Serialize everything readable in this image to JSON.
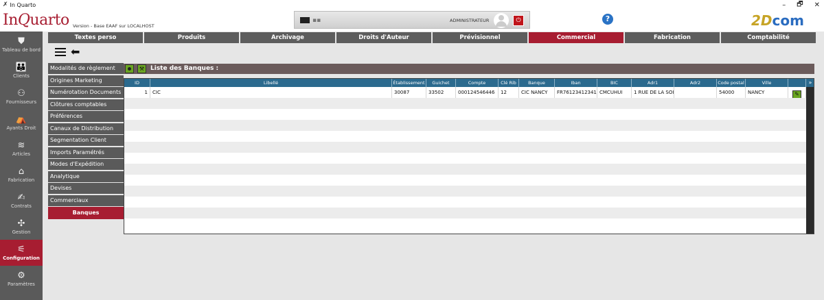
{
  "window": {
    "title": "In Quarto",
    "minimize": "–",
    "maximize": "🗗",
    "close": "✕"
  },
  "header": {
    "logo_prefix": "In",
    "logo_q": "Q",
    "logo_suffix": "uarto",
    "version": "Version - Base EAAF sur LOCALHOST",
    "user_name": "ADMINISTRATEUR",
    "help": "?",
    "brand_two": "2D",
    "brand_com": "com"
  },
  "leftnav": [
    {
      "label": "Tableau de bord",
      "icon": "⛊"
    },
    {
      "label": "Clients",
      "icon": "👪"
    },
    {
      "label": "Fournisseurs",
      "icon": "⚇"
    },
    {
      "label": "Ayants Droit",
      "icon": "⛺"
    },
    {
      "label": "Articles",
      "icon": "≋"
    },
    {
      "label": "Fabrication",
      "icon": "⌂"
    },
    {
      "label": "Contrats",
      "icon": "✍"
    },
    {
      "label": "Gestion",
      "icon": "✣"
    },
    {
      "label": "Configuration",
      "icon": "⚟"
    },
    {
      "label": "Paramètres",
      "icon": "⚙"
    }
  ],
  "tabs": [
    "Textes perso",
    "Produits",
    "Archivage",
    "Droits d'Auteur",
    "Prévisionnel",
    "Commercial",
    "Fabrication",
    "Comptabilité"
  ],
  "submenu": [
    "Modalités de règlement",
    "Origines Marketing",
    "Numérotation Documents",
    "Clôtures comptables",
    "Préférences",
    "Canaux de Distribution",
    "Segmentation Client",
    "Imports Paramétrés",
    "Modes d'Expédition",
    "Analytique",
    "Devises",
    "Commerciaux",
    "Banques"
  ],
  "list": {
    "title": "Liste des Banques :",
    "columns": [
      "ID",
      "Libellé",
      "Établissement",
      "Guichet",
      "Compte",
      "Clé Rib",
      "Banque",
      "Iban",
      "BIC",
      "Adr1",
      "Adr2",
      "Code postal",
      "Ville",
      ""
    ],
    "rows": [
      [
        "1",
        "CIC",
        "30087",
        "33502",
        "000124546446",
        "12",
        "CIC NANCY",
        "FR76123412341",
        "CMCUHUI",
        "1 RUE DE LA SOI",
        "",
        "54000",
        "NANCY"
      ]
    ],
    "edit_icon": "✎",
    "expand_icon": "»"
  }
}
